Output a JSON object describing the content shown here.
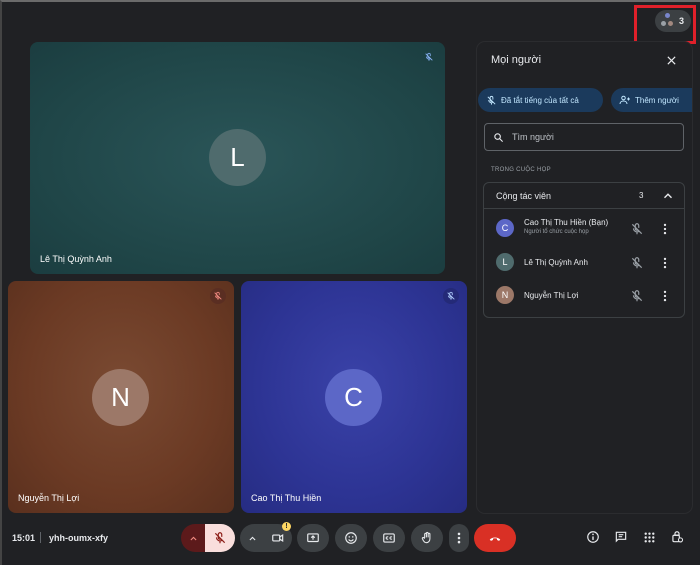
{
  "header": {
    "participant_count": "3"
  },
  "tiles": [
    {
      "name": "Lê Thị Quỳnh Anh",
      "initial": "L"
    },
    {
      "name": "Nguyễn Thị Lợi",
      "initial": "N"
    },
    {
      "name": "Cao Thị Thu Hiền",
      "initial": "C"
    }
  ],
  "panel": {
    "title": "Mọi người",
    "mute_all_label": "Đã tắt tiếng của tất cả",
    "add_people_label": "Thêm người",
    "search_placeholder": "Tìm người",
    "section_label": "TRONG CUỘC HỌP",
    "group": {
      "title": "Cộng tác viên",
      "count": "3",
      "people": [
        {
          "initial": "C",
          "name": "Cao Thị Thu Hiền (Bạn)",
          "subtitle": "Người tổ chức cuộc họp"
        },
        {
          "initial": "L",
          "name": "Lê Thị Quỳnh Anh",
          "subtitle": ""
        },
        {
          "initial": "N",
          "name": "Nguyễn Thị Lợi",
          "subtitle": ""
        }
      ]
    }
  },
  "footer": {
    "time": "15:01",
    "meeting_code": "yhh-oumx-xfy"
  },
  "icons": [
    "mic-off-icon",
    "close-icon",
    "person-add-icon",
    "search-icon",
    "chevron-up-icon",
    "more-vert-icon",
    "camera-icon",
    "present-icon",
    "emoji-icon",
    "captions-icon",
    "raise-hand-icon",
    "hang-up-icon",
    "info-icon",
    "chat-icon",
    "apps-icon",
    "host-controls-icon"
  ],
  "colors": {
    "tile_teal": "#1e4a4d",
    "tile_brown": "#6b3a24",
    "tile_blue": "#2b318f",
    "accent_chip": "#1b3a5c",
    "hangup": "#d93025",
    "mic_off": "#5c1a1b"
  }
}
